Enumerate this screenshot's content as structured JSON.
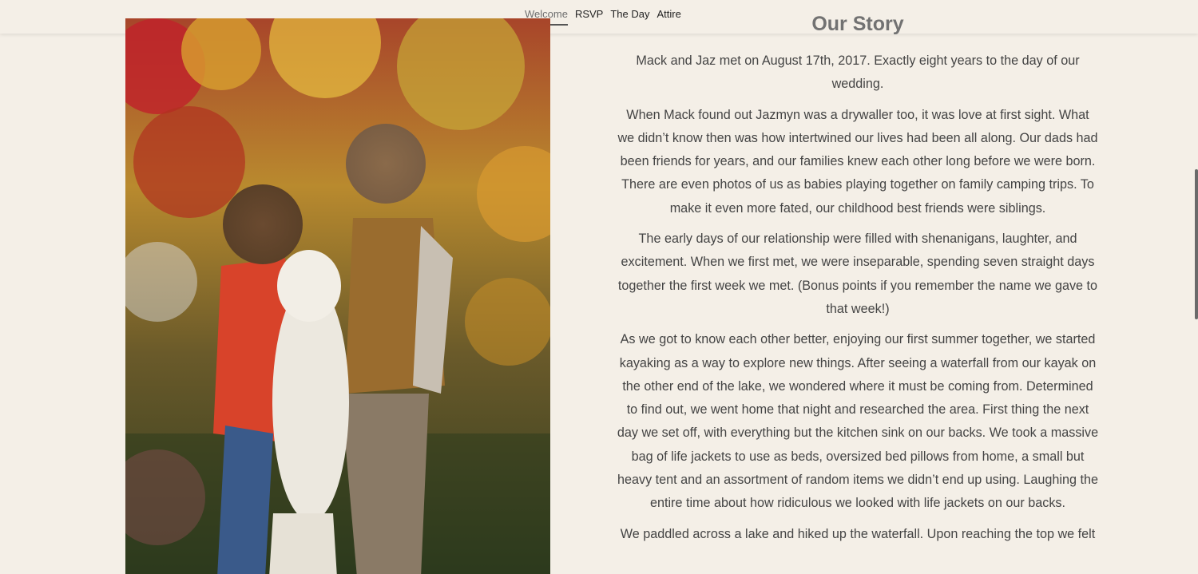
{
  "nav": {
    "items": [
      {
        "label": "Welcome",
        "active": true
      },
      {
        "label": "RSVP",
        "active": false
      },
      {
        "label": "The Day",
        "active": false
      },
      {
        "label": "Attire",
        "active": false
      }
    ]
  },
  "story": {
    "title": "Our Story",
    "paragraphs": [
      "Mack and Jaz met on August 17th, 2017. Exactly eight years to the day of our wedding.",
      "When Mack found out Jazmyn was a drywaller too, it was love at first sight. What we didn’t know then was how intertwined our lives had been all along. Our dads had been friends for years, and our families knew each other long before we were born. There are even photos of us as babies playing together on family camping trips. To make it even more fated, our childhood best friends were siblings.",
      "The early days of our relationship were filled with shenanigans, laughter, and excitement. When we first met, we were inseparable, spending seven straight days together the first week we met. (Bonus points if you remember the name we gave to that week!)",
      "As we got to know each other better, enjoying our first summer together, we started kayaking as a way to explore new things. After seeing a waterfall from our kayak on the other end of the lake, we wondered where it must be coming from. Determined to find out, we went home that night and researched the area. First thing the next day we set off, with everything but the kitchen sink on our backs. We took a massive bag of life jackets to use as beds, oversized bed pillows from home, a small but heavy tent and an assortment of random items we didn’t end up using. Laughing the entire time about how ridiculous we looked with life jackets on our backs.",
      "We paddled across a lake and hiked up the waterfall. Upon reaching the top we felt"
    ]
  },
  "colors": {
    "background": "#f4efe7",
    "text": "#444444",
    "title": "#727272"
  }
}
